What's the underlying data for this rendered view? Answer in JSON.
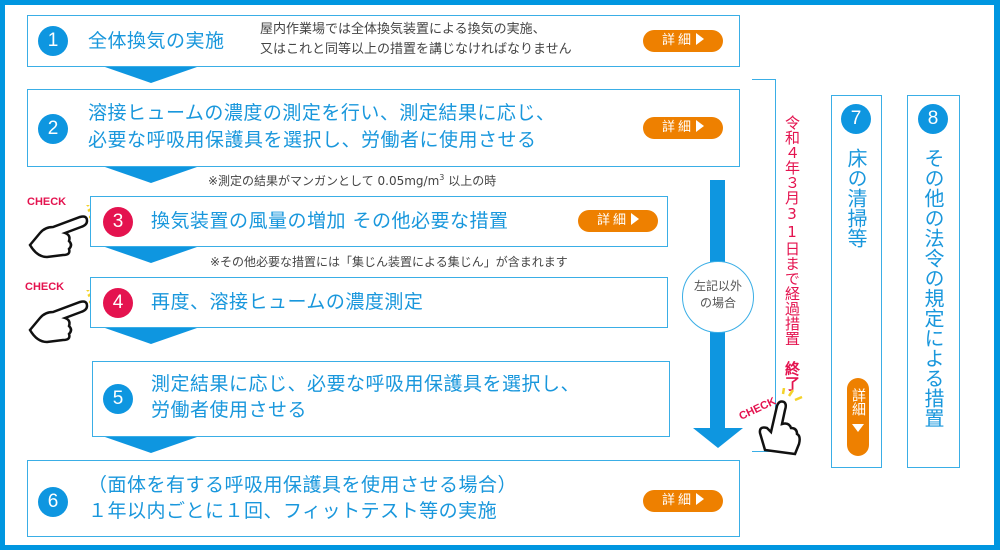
{
  "colors": {
    "primary": "#0e96e0",
    "accent": "#ee8000",
    "alert": "#e4134f",
    "text": "#444444"
  },
  "steps": [
    {
      "num": "1",
      "title": "全体換気の実施",
      "desc_line1": "屋内作業場では全体換気装置による換気の実施、",
      "desc_line2": "又はこれと同等以上の措置を講じなければなりません",
      "button": "詳細"
    },
    {
      "num": "2",
      "title_line1": "溶接ヒュームの濃度の測定を行い、測定結果に応じ、",
      "title_line2": "必要な呼吸用保護具を選択し、労働者に使用させる",
      "button": "詳細",
      "note_prefix": "※測定の結果がマンガンとして 0.05mg/m",
      "note_sup": "3",
      "note_suffix": " 以上の時"
    },
    {
      "num": "3",
      "title": "換気装置の風量の増加 その他必要な措置",
      "button": "詳細",
      "check": "CHECK",
      "note": "※その他必要な措置には「集じん装置による集じん」が含まれます"
    },
    {
      "num": "4",
      "title": "再度、溶接ヒュームの濃度測定",
      "check": "CHECK"
    },
    {
      "num": "5",
      "title_line1": "測定結果に応じ、必要な呼吸用保護具を選択し、",
      "title_line2": "労働者使用させる"
    },
    {
      "num": "6",
      "title_line1": "（面体を有する呼吸用保護具を使用させる場合）",
      "title_line2": "１年以内ごとに１回、フィットテスト等の実施",
      "button": "詳細"
    },
    {
      "num": "7",
      "title": "床の清掃等",
      "button": "詳細"
    },
    {
      "num": "8",
      "title": "その他の法令の規定による措置"
    }
  ],
  "bypass": {
    "circle_line1": "左記以外",
    "circle_line2": "の場合"
  },
  "transition": {
    "text": "令和４年３月31日まで経過措置",
    "end": "終了",
    "check": "CHECK"
  }
}
